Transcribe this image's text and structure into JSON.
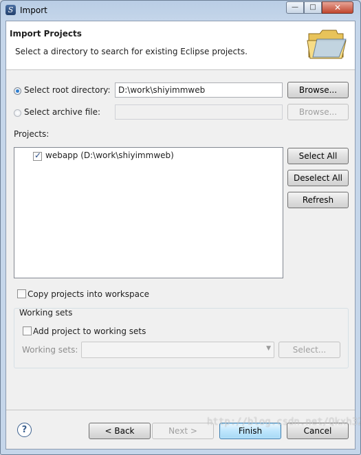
{
  "window": {
    "title": "Import"
  },
  "header": {
    "title": "Import Projects",
    "description": "Select a directory to search for existing Eclipse projects."
  },
  "source": {
    "root_label": "Select root directory:",
    "root_value": "D:\\work\\shiyimmweb",
    "root_browse": "Browse...",
    "archive_label": "Select archive file:",
    "archive_value": "",
    "archive_browse": "Browse..."
  },
  "projects": {
    "label": "Projects:",
    "items": [
      {
        "label": "webapp (D:\\work\\shiyimmweb)",
        "checked": true
      }
    ],
    "select_all": "Select All",
    "deselect_all": "Deselect All",
    "refresh": "Refresh"
  },
  "options": {
    "copy_label": "Copy projects into workspace"
  },
  "working_sets": {
    "group_label": "Working sets",
    "add_label": "Add project to working sets",
    "sets_label": "Working sets:",
    "select_button": "Select..."
  },
  "footer": {
    "back": "< Back",
    "next": "Next >",
    "finish": "Finish",
    "cancel": "Cancel"
  },
  "watermark": "http://blog.csdn.net/Qkxh320"
}
